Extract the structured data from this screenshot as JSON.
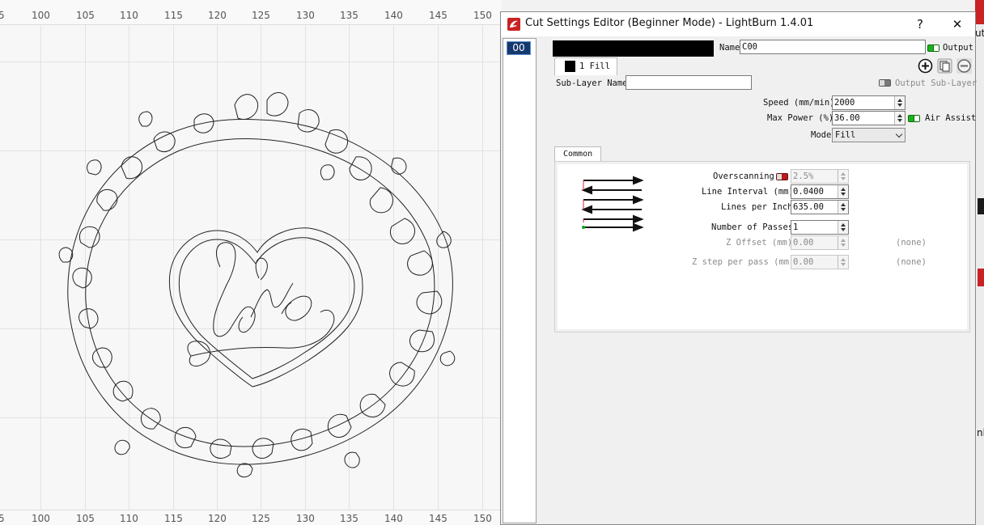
{
  "canvas": {
    "ruler_top_numbers": [
      "5",
      "100",
      "105",
      "110",
      "115",
      "120",
      "125",
      "130",
      "135",
      "140",
      "145",
      "150"
    ],
    "ruler_bottom_numbers": [
      "5",
      "100",
      "105",
      "110",
      "115",
      "120",
      "125",
      "130",
      "135",
      "140",
      "145",
      "150"
    ]
  },
  "background_right": {
    "top_text": "ut",
    "bottom_text": "nb"
  },
  "dialog": {
    "title": "Cut Settings Editor (Beginner Mode) - LightBurn 1.4.01",
    "help_label": "?",
    "close_label": "✕",
    "layers": [
      {
        "id": "00",
        "color": "#000000"
      }
    ],
    "name_label": "Name",
    "name_value": "C00",
    "output_label": "Output",
    "output_on": true,
    "sublayer_tab_label": "1 Fill",
    "sublayer_name_label": "Sub-Layer Name",
    "sublayer_name_value": "",
    "output_sublayer_label": "Output Sub-Layer",
    "output_sublayer_on": false,
    "add_icon": "plus-circle-icon",
    "duplicate_icon": "copy-icon",
    "remove_icon": "minus-circle-icon",
    "speed_label": "Speed (mm/min)",
    "speed_value": "2000",
    "max_power_label": "Max Power (%)",
    "max_power_value": "36.00",
    "air_assist_label": "Air Assist",
    "air_assist_on": true,
    "mode_label": "Mode",
    "mode_value": "Fill",
    "common_tab_label": "Common",
    "overscanning_label": "Overscanning",
    "overscanning_value": "2.5%",
    "overscanning_on": false,
    "line_interval_label": "Line Interval (mm)",
    "line_interval_value": "0.0400",
    "lines_per_inch_label": "Lines per Inch",
    "lines_per_inch_value": "635.00",
    "passes_label": "Number of Passes",
    "passes_value": "1",
    "z_offset_label": "Z Offset (mm)",
    "z_offset_value": "0.00",
    "z_offset_none": "(none)",
    "z_step_label": "Z step per pass (mm)",
    "z_step_value": "0.00",
    "z_step_none": "(none)"
  },
  "colors": {
    "layer_highlight": "#15396e",
    "toggle_on": "#1db31d",
    "toggle_off_red": "#b81c1c",
    "app_accent": "#c92222"
  }
}
